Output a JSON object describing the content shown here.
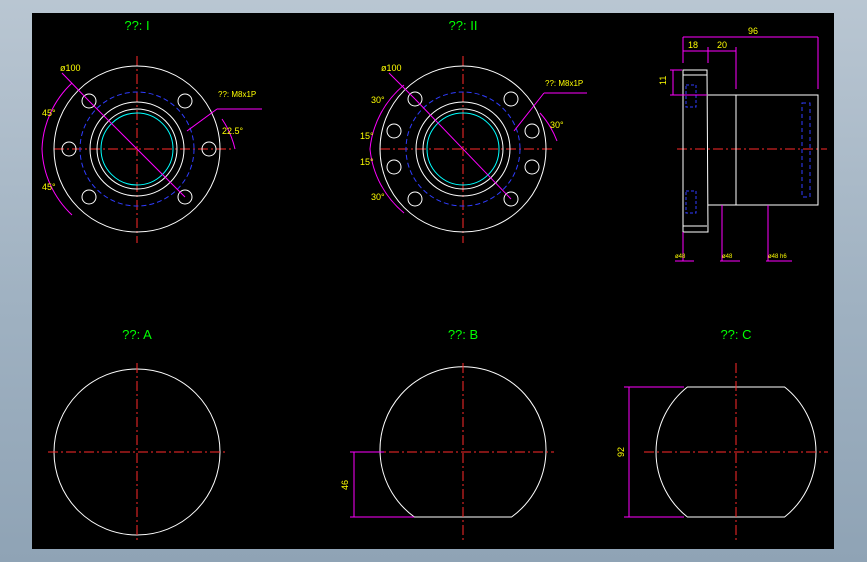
{
  "colors": {
    "background": "#000000",
    "outline": "#ffffff",
    "centerline": "#ff2a2a",
    "hidden": "#2f3cff",
    "dimension": "#ff00ff",
    "text": "#00ff00",
    "dimension_text": "#ffff00"
  },
  "views": {
    "type1": {
      "title": "??: I",
      "dia_label": "ø100",
      "thread_label": "??: M8x1P",
      "angle_top": "45°",
      "angle_bottom": "45°",
      "angle_right": "22.5°"
    },
    "type2": {
      "title": "??: II",
      "dia_label": "ø100",
      "thread_label": "??: M8x1P",
      "angle_1": "30°",
      "angle_2": "15°",
      "angle_3": "15°",
      "angle_4": "30°",
      "angle_right": "30°"
    },
    "side": {
      "overall": "96",
      "flange_width": "18",
      "step": "20",
      "height": "11",
      "note_1": "ø48",
      "note_2": "ø48",
      "note_3": "ø48 h6"
    },
    "a": {
      "title": "??: A"
    },
    "b": {
      "title": "??: B",
      "dim": "46"
    },
    "c": {
      "title": "??: C",
      "dim": "92"
    }
  }
}
